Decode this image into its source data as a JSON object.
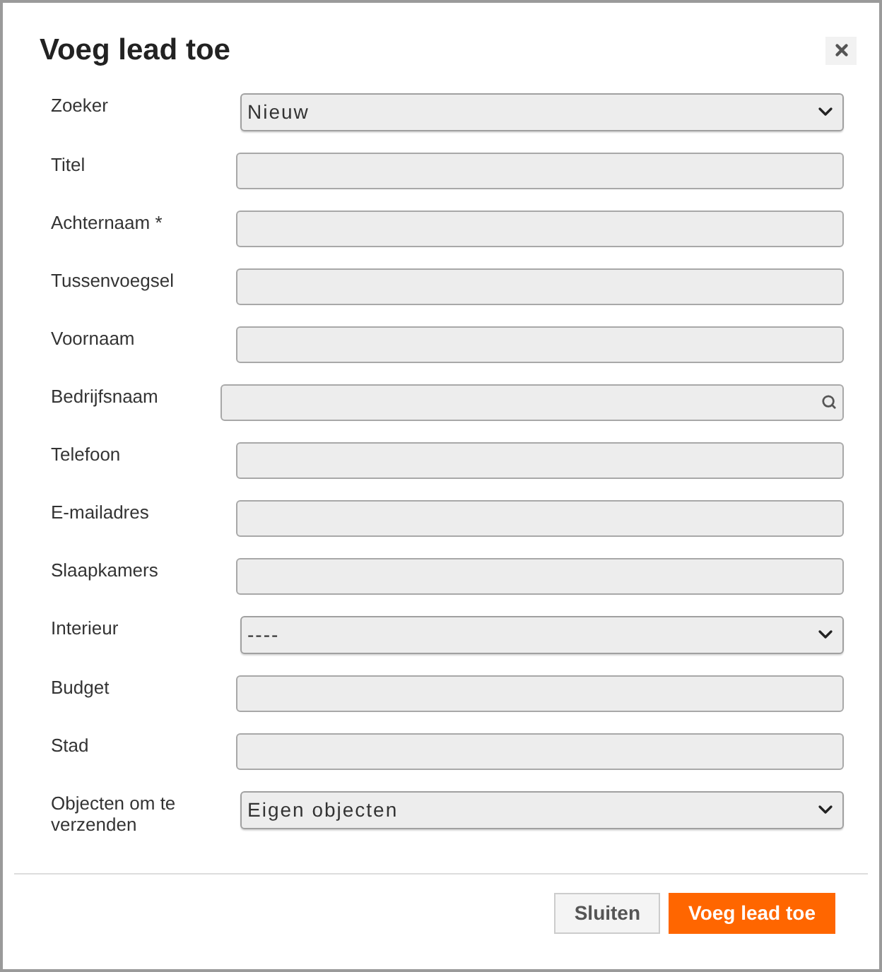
{
  "dialog": {
    "title": "Voeg lead toe"
  },
  "fields": [
    {
      "label": "Zoeker",
      "kind": "select",
      "value": "Nieuw"
    },
    {
      "label": "Titel",
      "kind": "text"
    },
    {
      "label": "Achternaam *",
      "kind": "text"
    },
    {
      "label": "Tussenvoegsel",
      "kind": "text"
    },
    {
      "label": "Voornaam",
      "kind": "text"
    },
    {
      "label": "Bedrijfsnaam",
      "kind": "search"
    },
    {
      "label": "Telefoon",
      "kind": "text"
    },
    {
      "label": "E-mailadres",
      "kind": "text"
    },
    {
      "label": "Slaapkamers",
      "kind": "text"
    },
    {
      "label": "Interieur",
      "kind": "select",
      "value": "----"
    },
    {
      "label": "Budget",
      "kind": "text"
    },
    {
      "label": "Stad",
      "kind": "text"
    },
    {
      "label": "Objecten om te verzenden",
      "kind": "select",
      "value": "Eigen objecten"
    }
  ],
  "buttons": [
    {
      "label": "Sluiten",
      "kind": "secondary"
    },
    {
      "label": "Voeg lead toe",
      "kind": "primary"
    }
  ]
}
